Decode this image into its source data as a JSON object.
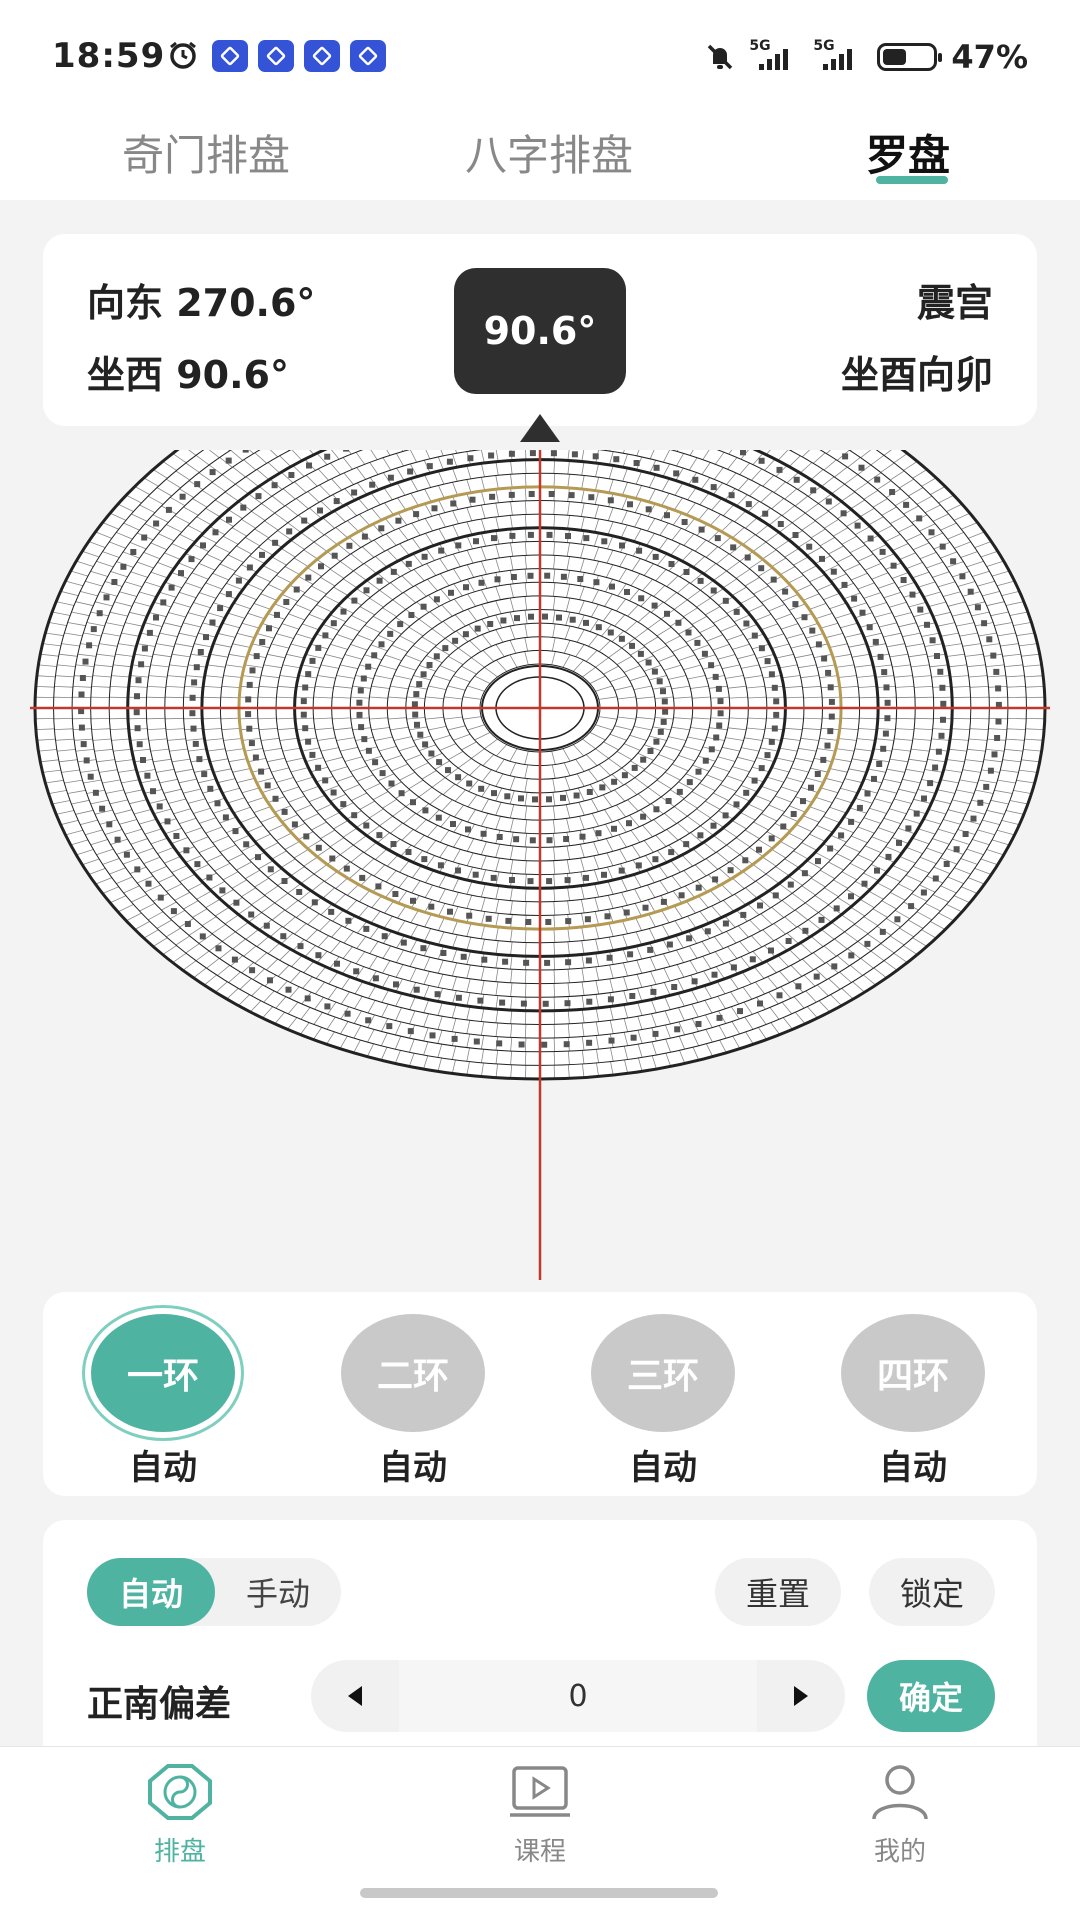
{
  "status_bar": {
    "time": "18:59",
    "icons": [
      "alarm-icon",
      "app-icon",
      "app-icon",
      "app-icon",
      "app-icon",
      "mute-icon",
      "signal-5g-icon",
      "signal-5g-icon",
      "battery-icon"
    ],
    "network_label": "5G",
    "battery_level": 0.47,
    "battery_text": "47%"
  },
  "tabs": {
    "items": [
      "奇门排盘",
      "八字排盘",
      "罗盘"
    ],
    "active_index": 2
  },
  "reading": {
    "facing": "向东 270.6°",
    "sitting": "坐西 90.6°",
    "degree": "90.6°",
    "palace": "震宫",
    "orientation": "坐酉向卯"
  },
  "rings": {
    "items": [
      {
        "label": "一环",
        "mode": "自动"
      },
      {
        "label": "二环",
        "mode": "自动"
      },
      {
        "label": "三环",
        "mode": "自动"
      },
      {
        "label": "四环",
        "mode": "自动"
      }
    ],
    "active_index": 0
  },
  "controls": {
    "auto_label": "自动",
    "manual_label": "手动",
    "reset_label": "重置",
    "lock_label": "锁定",
    "deviation_label": "正南偏差",
    "deviation_value": "0",
    "confirm_label": "确定"
  },
  "bottom_nav": {
    "items": [
      {
        "label": "排盘",
        "icon": "bagua-icon"
      },
      {
        "label": "课程",
        "icon": "video-course-icon"
      },
      {
        "label": "我的",
        "icon": "user-icon"
      }
    ],
    "active_index": 0
  },
  "colors": {
    "accent": "#4fb3a1",
    "inactive_ring": "#c9c9c9",
    "crosshair": "#c0392b",
    "dark_badge": "#2f2f2f"
  }
}
